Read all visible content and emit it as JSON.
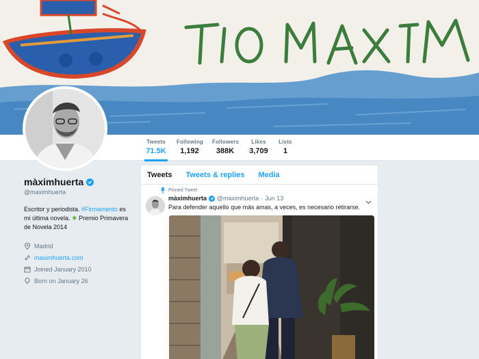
{
  "banner": {
    "drawn_text": "TIO MAXIM",
    "colors": {
      "sky": "#f2eee8",
      "water": "#4a8fc9",
      "letters": "#2e7d32",
      "boat_red": "#d9472b",
      "boat_blue": "#1f5fb0"
    }
  },
  "nav": {
    "stats": [
      {
        "label": "Tweets",
        "value": "71.5K"
      },
      {
        "label": "Following",
        "value": "1,192"
      },
      {
        "label": "Followers",
        "value": "388K"
      },
      {
        "label": "Likes",
        "value": "3,709"
      },
      {
        "label": "Lists",
        "value": "1"
      }
    ],
    "active": 0
  },
  "profile": {
    "name": "màximhuerta",
    "handle": "@maximhuerta",
    "bio_start": "Escritor y periodista. ",
    "bio_tag": "#Firmamento",
    "bio_mid": " es mi última novela. ",
    "bio_end": " Premio Primavera de Novela 2014",
    "location": "Madrid",
    "website": "maximhuerta.com",
    "joined": "Joined January 2010",
    "born": "Born on January 26"
  },
  "timeline": {
    "tabs": [
      "Tweets",
      "Tweets & replies",
      "Media"
    ],
    "pinned_label": "Pinned Tweet",
    "tweet": {
      "name": "màximhuerta",
      "handle": "@maximhuerta",
      "sep": "·",
      "date": "Jun 13",
      "text": "Para defender aquello que más amas, a veces, es necesario retirarse."
    }
  },
  "accent": "#1da1f2"
}
